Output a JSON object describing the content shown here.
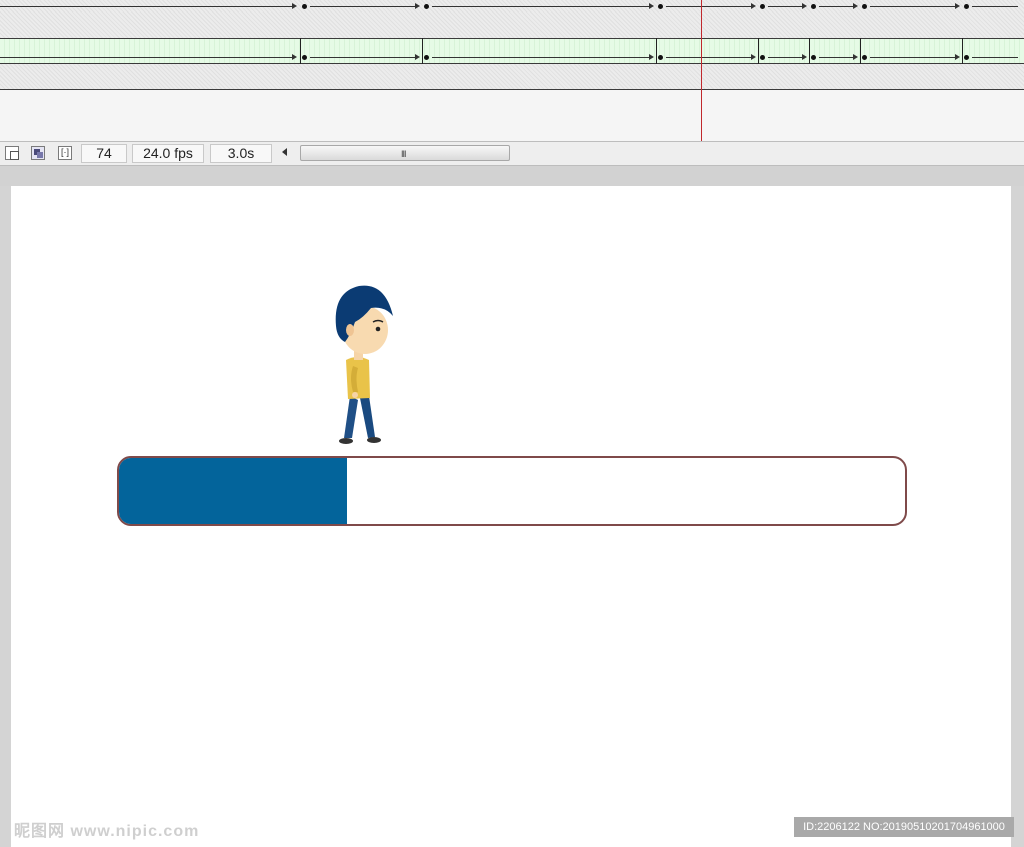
{
  "timeline": {
    "playhead_frame": 74,
    "icons": [
      "onion-skin-icon",
      "onion-skin-outlines-icon",
      "edit-multiple-frames-icon"
    ]
  },
  "statusbar": {
    "current_frame": "74",
    "frame_rate": "24.0 fps",
    "elapsed_time": "3.0s",
    "scroll_grip": "III"
  },
  "stage": {
    "progress_fraction": 0.29,
    "progress_fill_color": "#03649b",
    "progress_border_color": "#7f4a4a",
    "character": "walking-boy-illustration"
  },
  "watermark": {
    "logo_text": "昵图网 www.nipic.com",
    "id_text": "ID:2206122 NO:20190510201704961000"
  }
}
